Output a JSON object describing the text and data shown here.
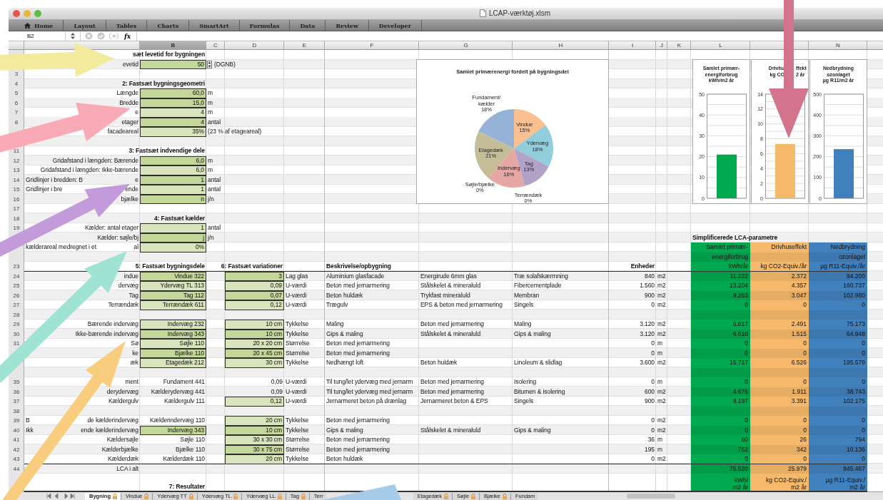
{
  "window": {
    "title": "LCAP-værktøj.xlsm"
  },
  "ribbon_tabs": [
    {
      "label": "Home",
      "kind": "home"
    },
    {
      "label": "Layout",
      "kind": "plain"
    },
    {
      "label": "Tables",
      "kind": "plain"
    },
    {
      "label": "Charts",
      "kind": "plain"
    },
    {
      "label": "SmartArt",
      "kind": "plain"
    },
    {
      "label": "Formulas",
      "kind": "plain"
    },
    {
      "label": "Data",
      "kind": "plain"
    },
    {
      "label": "Review",
      "kind": "plain"
    },
    {
      "label": "Developer",
      "kind": "plain"
    }
  ],
  "formula_bar": {
    "name_box": "B2",
    "fx": "fx"
  },
  "column_headers": {
    "B": {
      "letter": "B",
      "selected": true
    },
    "C": {
      "letter": "C",
      "selected": false
    },
    "D": {
      "letter": "D",
      "selected": false
    },
    "E": {
      "letter": "E",
      "selected": false
    },
    "F": {
      "letter": "F",
      "selected": false
    },
    "G": {
      "letter": "G",
      "selected": false
    },
    "H": {
      "letter": "H",
      "selected": false
    },
    "I": {
      "letter": "I",
      "selected": false
    },
    "J": {
      "letter": "J",
      "selected": false
    },
    "K": {
      "letter": "K",
      "selected": false
    },
    "L": {
      "letter": "L",
      "selected": false
    },
    "N": {
      "letter": "N",
      "selected": false
    }
  },
  "rows": [
    {
      "B": {
        "kind": "heading",
        "text": "sæt levetid for bygningen"
      }
    },
    {
      "A": {
        "kind": "label",
        "text": "evetid"
      },
      "B": {
        "kind": "input",
        "dark": true,
        "text": "50"
      },
      "C": {
        "kind": "text",
        "stepper": true,
        "text": "(DGNB)"
      }
    },
    {
      "n": "3"
    },
    {
      "n": "4",
      "B": {
        "kind": "heading",
        "text": "2: Fastsæt bygningsgeometri"
      }
    },
    {
      "n": "5",
      "A": {
        "kind": "label",
        "text": "Længde"
      },
      "B": {
        "kind": "input",
        "dark": true,
        "text": "60,0"
      },
      "C": {
        "kind": "text",
        "text": "m"
      }
    },
    {
      "n": "6",
      "A": {
        "kind": "label",
        "text": "Bredde"
      },
      "B": {
        "kind": "input",
        "dark": true,
        "text": "15,0"
      },
      "C": {
        "kind": "text",
        "text": "m"
      }
    },
    {
      "n": "7",
      "A": {
        "kind": "label",
        "text": "e"
      },
      "B": {
        "kind": "input",
        "dark": false,
        "text": "4"
      },
      "C": {
        "kind": "text",
        "text": "m"
      }
    },
    {
      "n": "8",
      "A": {
        "kind": "label",
        "text": "etager"
      },
      "B": {
        "kind": "input",
        "dark": true,
        "text": "4"
      },
      "C": {
        "kind": "text",
        "text": "antal"
      }
    },
    {
      "A": {
        "kind": "label",
        "text": "facadeareal"
      },
      "B": {
        "kind": "input",
        "dark": false,
        "text": "35%"
      },
      "C": {
        "kind": "text",
        "text": "(23 % af etageareal)"
      }
    },
    {},
    {
      "n": "11",
      "B": {
        "kind": "heading",
        "text": "3: Fastsæt indvendige dele"
      }
    },
    {
      "n": "12",
      "A": {
        "kind": "label",
        "text": "Gridafstand i længden: Bærende"
      },
      "B": {
        "kind": "input",
        "dark": true,
        "text": "6,0"
      },
      "C": {
        "kind": "text",
        "text": "m"
      }
    },
    {
      "n": "13",
      "A": {
        "kind": "label",
        "text": "Gridafstand i længden: Ikke-bærende"
      },
      "B": {
        "kind": "input",
        "dark": false,
        "text": "6,0"
      },
      "C": {
        "kind": "text",
        "text": "m"
      }
    },
    {
      "n": "14",
      "A": {
        "kind": "label",
        "parts": [
          "Gridlinjer i bredden: B",
          "e"
        ]
      },
      "B": {
        "kind": "input",
        "dark": true,
        "text": "1"
      },
      "C": {
        "kind": "text",
        "text": "antal"
      }
    },
    {
      "n": "15",
      "A": {
        "kind": "label",
        "parts": [
          "Gridlinjer i bre",
          "ende"
        ]
      },
      "B": {
        "kind": "input",
        "dark": false,
        "text": "1"
      },
      "C": {
        "kind": "text",
        "text": "antal"
      }
    },
    {
      "n": "16",
      "A": {
        "kind": "label",
        "text": "bjælke"
      },
      "B": {
        "kind": "input",
        "dark": true,
        "text": "n"
      },
      "C": {
        "kind": "text",
        "text": "j/n"
      }
    },
    {
      "n": "17"
    },
    {
      "n": "18",
      "B": {
        "kind": "heading",
        "text": "4: Fastsæt kælder"
      }
    },
    {
      "n": "19",
      "A": {
        "kind": "label",
        "text": "Kælder: antal etager"
      },
      "B": {
        "kind": "input",
        "dark": false,
        "text": "1"
      },
      "C": {
        "kind": "text",
        "text": "antal"
      }
    },
    {
      "A": {
        "kind": "label",
        "text": "Kælder: søjle/bj"
      },
      "B": {
        "kind": "input",
        "dark": true,
        "text": "j"
      },
      "C": {
        "kind": "text",
        "text": "j/n"
      }
    },
    {
      "A": {
        "kind": "label",
        "parts": [
          "kælderareal medregnet i et",
          "al"
        ]
      },
      "B": {
        "kind": "input",
        "dark": false,
        "text": "0%"
      },
      "L": {
        "text": "Samlet primær-"
      },
      "M": {
        "text": "Drivhuseffekt"
      },
      "N": {
        "text": "Nedbrydning"
      }
    },
    {
      "L": {
        "text": "energiforbrug"
      },
      "N": {
        "text": "ozonlaget"
      }
    },
    {
      "n": "23",
      "rule_below": true,
      "B": {
        "kind": "heading",
        "text": "5: Fastsæt bygningsdele"
      },
      "D": {
        "kind": "heading",
        "text": "6: Fastsæt variationer"
      },
      "F": {
        "kind": "caption",
        "text": "Beskrivelse/opbygning"
      },
      "I": {
        "kind": "heading",
        "text": "Enheder"
      },
      "L": {
        "text": "kWh/år"
      },
      "M": {
        "text": "kg CO2-Equiv./år"
      },
      "N": {
        "text": "µg R11-Equiv./år"
      }
    },
    {
      "n": "24",
      "A": {
        "kind": "label",
        "text": "indue"
      },
      "B": {
        "kind": "input",
        "dark": true,
        "text": "Vindue 322"
      },
      "D": {
        "kind": "input",
        "dark": true,
        "text": "3"
      },
      "E": {
        "kind": "text",
        "text": "Lag glas"
      },
      "F": {
        "kind": "text",
        "text": "Aluminium glasfacade"
      },
      "G": {
        "kind": "text",
        "text": "Energirude 6mm glas"
      },
      "H": {
        "kind": "text",
        "text": "Træ solafskærmning"
      },
      "I": {
        "kind": "num",
        "text": "840"
      },
      "J": {
        "kind": "text",
        "text": "m2"
      },
      "L": {
        "text": "11.222"
      },
      "M": {
        "text": "2.372"
      },
      "N": {
        "text": "94.200"
      }
    },
    {
      "n": "25",
      "A": {
        "kind": "label",
        "text": "dervæg"
      },
      "B": {
        "kind": "input",
        "dark": false,
        "text": "Ydervæg TL 313"
      },
      "D": {
        "kind": "input",
        "dark": false,
        "text": "0,09"
      },
      "E": {
        "kind": "text",
        "text": "U-værdi"
      },
      "F": {
        "kind": "text",
        "text": "Beton med jernarmering"
      },
      "G": {
        "kind": "text",
        "text": "Stålskelet & mineraluld"
      },
      "H": {
        "kind": "text",
        "text": "Fibercementplade"
      },
      "I": {
        "kind": "num",
        "text": "1.560"
      },
      "J": {
        "kind": "text",
        "text": "m2"
      },
      "L": {
        "text": "13.204"
      },
      "M": {
        "text": "4.357"
      },
      "N": {
        "text": "160.737"
      }
    },
    {
      "n": "26",
      "A": {
        "kind": "label",
        "text": "Tag"
      },
      "B": {
        "kind": "input",
        "dark": true,
        "text": "Tag 112"
      },
      "D": {
        "kind": "input",
        "dark": true,
        "text": "0,07"
      },
      "E": {
        "kind": "text",
        "text": "U-værdi"
      },
      "F": {
        "kind": "text",
        "text": "Beton huldæk"
      },
      "G": {
        "kind": "text",
        "text": "Trykfast mineraluld"
      },
      "H": {
        "kind": "text",
        "text": "Membran"
      },
      "I": {
        "kind": "num",
        "text": "900"
      },
      "J": {
        "kind": "text",
        "text": "m2"
      },
      "L": {
        "text": "9.263"
      },
      "M": {
        "text": "3.047"
      },
      "N": {
        "text": "102.980"
      }
    },
    {
      "n": "27",
      "A": {
        "kind": "label",
        "text": "Terrændæk"
      },
      "B": {
        "kind": "input",
        "dark": false,
        "text": "Terrændæk 611"
      },
      "D": {
        "kind": "input",
        "dark": false,
        "text": "0,12"
      },
      "E": {
        "kind": "text",
        "text": "U-værdi"
      },
      "F": {
        "kind": "text",
        "text": "Trægulv"
      },
      "G": {
        "kind": "text",
        "text": "EPS & beton med jernarmering"
      },
      "H": {
        "kind": "text",
        "text": "Singels"
      },
      "I": {
        "kind": "num",
        "text": "0"
      },
      "J": {
        "kind": "text",
        "text": "m2"
      },
      "L": {
        "text": "0"
      },
      "M": {
        "text": "0"
      },
      "N": {
        "text": "0"
      }
    },
    {
      "n": "28"
    },
    {
      "n": "29",
      "A": {
        "kind": "label",
        "text": "Bærende indervæg"
      },
      "B": {
        "kind": "input",
        "dark": false,
        "text": "Indervæg 232"
      },
      "D": {
        "kind": "input",
        "dark": false,
        "text": "10 cm"
      },
      "E": {
        "kind": "text",
        "text": "Tykkelse"
      },
      "F": {
        "kind": "text",
        "text": "Maling"
      },
      "G": {
        "kind": "text",
        "text": "Beton med jernarmering"
      },
      "H": {
        "kind": "text",
        "text": "Maling"
      },
      "I": {
        "kind": "num",
        "text": "3.120"
      },
      "J": {
        "kind": "text",
        "text": "m2"
      },
      "L": {
        "text": "5.817"
      },
      "M": {
        "text": "2.491"
      },
      "N": {
        "text": "75.173"
      }
    },
    {
      "n": "30",
      "A": {
        "kind": "label",
        "text": "Ikke-bærende indervæg"
      },
      "B": {
        "kind": "input",
        "dark": true,
        "text": "Indervæg 343"
      },
      "D": {
        "kind": "input",
        "dark": true,
        "text": "10 cm"
      },
      "E": {
        "kind": "text",
        "text": "Tykkelse"
      },
      "F": {
        "kind": "text",
        "text": "Gips & maling"
      },
      "G": {
        "kind": "text",
        "text": "Stålskelet & mineraluld"
      },
      "H": {
        "kind": "text",
        "text": "Gips & maling"
      },
      "I": {
        "kind": "num",
        "text": "3.120"
      },
      "J": {
        "kind": "text",
        "text": "m2"
      },
      "L": {
        "text": "6.610"
      },
      "M": {
        "text": "1.515"
      },
      "N": {
        "text": "64.948"
      }
    },
    {
      "n": "31",
      "A": {
        "kind": "label",
        "text": "Sø"
      },
      "B": {
        "kind": "input",
        "dark": false,
        "text": "Søjle 110"
      },
      "D": {
        "kind": "input",
        "dark": false,
        "text": "20 x 20 cm"
      },
      "E": {
        "kind": "text",
        "text": "Størrelse"
      },
      "F": {
        "kind": "text",
        "text": "Beton med jernarmering"
      },
      "I": {
        "kind": "num",
        "text": "0"
      },
      "J": {
        "kind": "text",
        "text": "m"
      },
      "L": {
        "text": "0"
      },
      "M": {
        "text": "0"
      },
      "N": {
        "text": "0"
      }
    },
    {
      "A": {
        "kind": "label",
        "text": "ke"
      },
      "B": {
        "kind": "input",
        "dark": true,
        "text": "Bjælke 110"
      },
      "D": {
        "kind": "input",
        "dark": true,
        "text": "20 x 45 cm"
      },
      "E": {
        "kind": "text",
        "text": "Størrelse"
      },
      "F": {
        "kind": "text",
        "text": "Beton med jernarmering"
      },
      "I": {
        "kind": "num",
        "text": "0"
      },
      "J": {
        "kind": "text",
        "text": "m"
      },
      "L": {
        "text": "0"
      },
      "M": {
        "text": "0"
      },
      "N": {
        "text": "0"
      }
    },
    {
      "A": {
        "kind": "label",
        "text": "æk"
      },
      "B": {
        "kind": "input",
        "dark": false,
        "text": "Etagedæk 212"
      },
      "D": {
        "kind": "input",
        "dark": false,
        "text": "30 cm"
      },
      "E": {
        "kind": "text",
        "text": "Tykkelse"
      },
      "F": {
        "kind": "text",
        "text": "Nedhængt loft"
      },
      "G": {
        "kind": "text",
        "text": "Beton huldæk"
      },
      "H": {
        "kind": "text",
        "text": "Linoleum & slidlag"
      },
      "I": {
        "kind": "num",
        "text": "3.600"
      },
      "J": {
        "kind": "text",
        "text": "m2"
      },
      "L": {
        "text": "15.717"
      },
      "M": {
        "text": "6.526"
      },
      "N": {
        "text": "195.579"
      }
    },
    {},
    {
      "n": "35",
      "A": {
        "kind": "label",
        "text": "ment"
      },
      "B": {
        "kind": "value",
        "text": "Fundament 441"
      },
      "D": {
        "kind": "value",
        "text": "0,09"
      },
      "E": {
        "kind": "text",
        "text": "U-værdi"
      },
      "F": {
        "kind": "text",
        "text": "Til tung/let ydervæg med jernarm"
      },
      "G": {
        "kind": "text",
        "text": "Beton med jernarmering"
      },
      "H": {
        "kind": "text",
        "text": "Isolering"
      },
      "I": {
        "kind": "num",
        "text": "0"
      },
      "J": {
        "kind": "text",
        "text": "m"
      },
      "L": {
        "text": "0"
      },
      "M": {
        "text": "0"
      },
      "N": {
        "text": "0"
      }
    },
    {
      "n": "36",
      "A": {
        "kind": "label",
        "text": "derydervæg"
      },
      "B": {
        "kind": "value",
        "text": "Kælderydervæg 441"
      },
      "D": {
        "kind": "value",
        "text": "0,09"
      },
      "E": {
        "kind": "text",
        "text": "U-værdi"
      },
      "F": {
        "kind": "text",
        "text": "Til tung/let ydervæg med jernarm"
      },
      "G": {
        "kind": "text",
        "text": "Beton med jernarmering"
      },
      "H": {
        "kind": "text",
        "text": "Bitumen & isolering"
      },
      "I": {
        "kind": "num",
        "text": "600"
      },
      "J": {
        "kind": "text",
        "text": "m2"
      },
      "L": {
        "text": "4.676"
      },
      "M": {
        "text": "1.911"
      },
      "N": {
        "text": "38.743"
      }
    },
    {
      "n": "37",
      "A": {
        "kind": "label",
        "text": "Kældergulv"
      },
      "B": {
        "kind": "value",
        "text": "Kældergulv 111"
      },
      "D": {
        "kind": "input",
        "dark": false,
        "text": "0,12"
      },
      "E": {
        "kind": "text",
        "text": "U-værdi"
      },
      "F": {
        "kind": "text",
        "text": "Jernarmeret beton på drænlag"
      },
      "G": {
        "kind": "text",
        "text": "Jernarmeret beton & EPS"
      },
      "H": {
        "kind": "text",
        "text": "Singels"
      },
      "I": {
        "kind": "num",
        "text": "900"
      },
      "J": {
        "kind": "text",
        "text": "m2"
      },
      "L": {
        "text": "8.197"
      },
      "M": {
        "text": "3.391"
      },
      "N": {
        "text": "102.175"
      }
    },
    {
      "n": "38"
    },
    {
      "n": "39",
      "A": {
        "kind": "label",
        "parts": [
          "B",
          "de kælderindervæg"
        ]
      },
      "B": {
        "kind": "value",
        "text": "Kælderindervæg 110"
      },
      "D": {
        "kind": "input",
        "dark": false,
        "text": "20 cm"
      },
      "E": {
        "kind": "text",
        "text": "Tykkelse"
      },
      "F": {
        "kind": "text",
        "text": "Beton med jernarmering"
      },
      "I": {
        "kind": "num",
        "text": "0"
      },
      "J": {
        "kind": "text",
        "text": "m2"
      },
      "L": {
        "text": "0"
      },
      "M": {
        "text": "0"
      },
      "N": {
        "text": "0"
      }
    },
    {
      "n": "40",
      "A": {
        "kind": "label",
        "parts": [
          "Ikk",
          "ende kælderindervæg"
        ]
      },
      "B": {
        "kind": "input",
        "dark": true,
        "text": "Indervæg 343"
      },
      "D": {
        "kind": "input",
        "dark": true,
        "text": "10 cm"
      },
      "E": {
        "kind": "text",
        "text": "Tykkelse"
      },
      "F": {
        "kind": "text",
        "text": "Gips & maling"
      },
      "G": {
        "kind": "text",
        "text": "Stålskelet & mineraluld"
      },
      "H": {
        "kind": "text",
        "text": "Gips & maling"
      },
      "I": {
        "kind": "num",
        "text": "0"
      },
      "J": {
        "kind": "text",
        "text": "m2"
      },
      "L": {
        "text": "0"
      },
      "M": {
        "text": "0"
      },
      "N": {
        "text": "0"
      }
    },
    {
      "n": "41",
      "A": {
        "kind": "label",
        "text": "Kældersøjle"
      },
      "B": {
        "kind": "value",
        "text": "Søjle 110"
      },
      "D": {
        "kind": "input",
        "dark": false,
        "text": "30 x 30 cm"
      },
      "E": {
        "kind": "text",
        "text": "Størrelse"
      },
      "F": {
        "kind": "text",
        "text": "Beton med jernarmering"
      },
      "I": {
        "kind": "num",
        "text": "36"
      },
      "J": {
        "kind": "text",
        "text": "m"
      },
      "L": {
        "text": "60"
      },
      "M": {
        "text": "26"
      },
      "N": {
        "text": "794"
      }
    },
    {
      "n": "42",
      "A": {
        "kind": "label",
        "text": "Kælderbjælke"
      },
      "B": {
        "kind": "value",
        "text": "Bjælke 110"
      },
      "D": {
        "kind": "input",
        "dark": true,
        "text": "30 x 75 cm"
      },
      "E": {
        "kind": "text",
        "text": "Størrelse"
      },
      "F": {
        "kind": "text",
        "text": "Beton med jernarmering"
      },
      "I": {
        "kind": "num",
        "text": "195"
      },
      "J": {
        "kind": "text",
        "text": "m"
      },
      "L": {
        "text": "752"
      },
      "M": {
        "text": "342"
      },
      "N": {
        "text": "10.136"
      }
    },
    {
      "n": "43",
      "rule_below": true,
      "A": {
        "kind": "label",
        "text": "Kælderdæk"
      },
      "B": {
        "kind": "value",
        "text": "Kælderdæk 110"
      },
      "D": {
        "kind": "input",
        "dark": false,
        "text": "20 cm"
      },
      "E": {
        "kind": "text",
        "text": "Tykkelse"
      },
      "F": {
        "kind": "text",
        "text": "Beton huldæk"
      },
      "I": {
        "kind": "num",
        "text": "0"
      },
      "J": {
        "kind": "text",
        "text": "m2"
      },
      "L": {
        "text": "0"
      },
      "M": {
        "text": "0"
      },
      "N": {
        "text": "0"
      }
    },
    {
      "n": "44",
      "A": {
        "kind": "label",
        "text": "LCA i alt"
      },
      "L": {
        "text": "75.520"
      },
      "M": {
        "text": "25.979"
      },
      "N": {
        "text": "845.467"
      }
    },
    {
      "rule_below": true,
      "B": {
        "kind": "heading",
        "text": "7: Resultater"
      },
      "L": {
        "lines": [
          "kWh/",
          "m2 år"
        ]
      },
      "M": {
        "lines": [
          "kg CO2-Equiv./",
          "m2 år"
        ]
      },
      "N": {
        "lines": [
          "µg R11-Equiv./",
          "m2 år"
        ]
      }
    }
  ],
  "lca": {
    "title": "Simplificerede LCA-parametre",
    "columns": {
      "L": {
        "color": "#00a84f"
      },
      "M": {
        "color": "#f6b96b"
      },
      "N": {
        "color": "#4080bd"
      }
    }
  },
  "charts": {
    "pie": {
      "chart_data": {
        "type": "pie",
        "title": "Samlet primærenergi fordelt på bygningsdel",
        "categories": [
          "Vindue",
          "Ydervæg",
          "Tag",
          "Terrændæk",
          "Indervæg",
          "Søjle/bjælke",
          "Etagedæk",
          "Fundament/ kælder"
        ],
        "values": [
          15,
          18,
          13,
          0,
          16,
          0,
          21,
          18
        ],
        "value_labels": [
          "15%",
          "18%",
          "13%",
          "0%",
          "16%",
          "0%",
          "21%",
          "18%"
        ],
        "colors": [
          "#fac090",
          "#92cddc",
          "#b3a2c7",
          "#d99694",
          "#e6a6a4",
          "#8db3e2",
          "#c4bd97",
          "#95b3d7"
        ]
      }
    },
    "bars": [
      {
        "title_lines": [
          "Samlet primær-",
          "energiforbrug",
          "kWh/m2 år"
        ],
        "chart_data": {
          "type": "bar",
          "grid": true,
          "ylim": [
            0,
            50
          ],
          "yticks": [
            0,
            10,
            20,
            30,
            40,
            50
          ],
          "series": [
            {
              "color": "#00a84f",
              "values": [
                21
              ]
            }
          ]
        }
      },
      {
        "title_parts": [
          [
            "Drivhu",
            "ffekt"
          ],
          [
            "kg CO",
            "2 år"
          ]
        ],
        "chart_data": {
          "type": "bar",
          "grid": true,
          "ylim": [
            0,
            14
          ],
          "yticks": [
            0,
            2,
            4,
            6,
            8,
            10,
            12,
            14
          ],
          "series": [
            {
              "color": "#f6b96b",
              "values": [
                7.3
              ]
            }
          ]
        }
      },
      {
        "title_lines": [
          "Nedbrydning",
          "ozonlaget",
          "µg R11/m2 år"
        ],
        "chart_data": {
          "type": "bar",
          "grid": true,
          "ylim": [
            0,
            500
          ],
          "yticks": [
            0,
            100,
            200,
            300,
            400,
            500
          ],
          "series": [
            {
              "color": "#4080bd",
              "values": [
                236
              ]
            }
          ]
        }
      }
    ]
  },
  "sheet_tabs": [
    {
      "label": "Bygning",
      "selected": true
    },
    {
      "label": "Vindue",
      "selected": false
    },
    {
      "label": "Ydervæg TT",
      "selected": false
    },
    {
      "label": "Ydervæg TL",
      "selected": false
    },
    {
      "label": "Ydervæg LL",
      "selected": false
    },
    {
      "label": "Tag",
      "selected": false
    },
    {
      "label": "Terr",
      "selected": false,
      "cut": true
    },
    {
      "label": "Etagedæk",
      "selected": false
    },
    {
      "label": "Søjle",
      "selected": false
    },
    {
      "label": "Bjælke",
      "selected": false
    },
    {
      "label": "Fundam",
      "selected": false,
      "cut": true
    }
  ]
}
